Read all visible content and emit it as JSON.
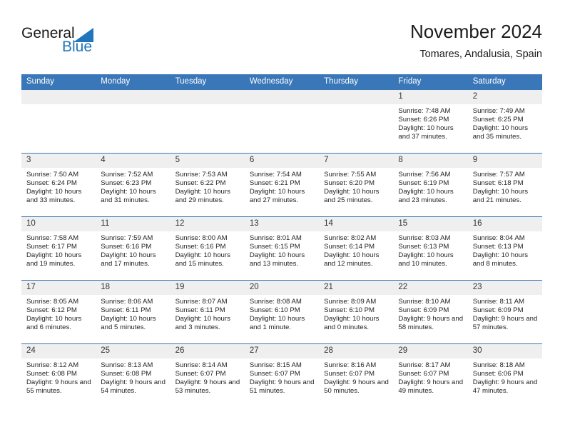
{
  "logo": {
    "word_top": "General",
    "word_bottom": "Blue",
    "accent_color": "#1f76bc"
  },
  "header": {
    "title": "November 2024",
    "subtitle": "Tomares, Andalusia, Spain"
  },
  "theme": {
    "header_bar": "#3a77b8",
    "daynum_band": "#efefef",
    "rule": "#3a77b8"
  },
  "weekday_headers": [
    "Sunday",
    "Monday",
    "Tuesday",
    "Wednesday",
    "Thursday",
    "Friday",
    "Saturday"
  ],
  "weeks": [
    [
      {
        "day": "",
        "empty": true
      },
      {
        "day": "",
        "empty": true
      },
      {
        "day": "",
        "empty": true
      },
      {
        "day": "",
        "empty": true
      },
      {
        "day": "",
        "empty": true
      },
      {
        "day": "1",
        "sunrise": "Sunrise: 7:48 AM",
        "sunset": "Sunset: 6:26 PM",
        "daylight": "Daylight: 10 hours and 37 minutes."
      },
      {
        "day": "2",
        "sunrise": "Sunrise: 7:49 AM",
        "sunset": "Sunset: 6:25 PM",
        "daylight": "Daylight: 10 hours and 35 minutes."
      }
    ],
    [
      {
        "day": "3",
        "sunrise": "Sunrise: 7:50 AM",
        "sunset": "Sunset: 6:24 PM",
        "daylight": "Daylight: 10 hours and 33 minutes."
      },
      {
        "day": "4",
        "sunrise": "Sunrise: 7:52 AM",
        "sunset": "Sunset: 6:23 PM",
        "daylight": "Daylight: 10 hours and 31 minutes."
      },
      {
        "day": "5",
        "sunrise": "Sunrise: 7:53 AM",
        "sunset": "Sunset: 6:22 PM",
        "daylight": "Daylight: 10 hours and 29 minutes."
      },
      {
        "day": "6",
        "sunrise": "Sunrise: 7:54 AM",
        "sunset": "Sunset: 6:21 PM",
        "daylight": "Daylight: 10 hours and 27 minutes."
      },
      {
        "day": "7",
        "sunrise": "Sunrise: 7:55 AM",
        "sunset": "Sunset: 6:20 PM",
        "daylight": "Daylight: 10 hours and 25 minutes."
      },
      {
        "day": "8",
        "sunrise": "Sunrise: 7:56 AM",
        "sunset": "Sunset: 6:19 PM",
        "daylight": "Daylight: 10 hours and 23 minutes."
      },
      {
        "day": "9",
        "sunrise": "Sunrise: 7:57 AM",
        "sunset": "Sunset: 6:18 PM",
        "daylight": "Daylight: 10 hours and 21 minutes."
      }
    ],
    [
      {
        "day": "10",
        "sunrise": "Sunrise: 7:58 AM",
        "sunset": "Sunset: 6:17 PM",
        "daylight": "Daylight: 10 hours and 19 minutes."
      },
      {
        "day": "11",
        "sunrise": "Sunrise: 7:59 AM",
        "sunset": "Sunset: 6:16 PM",
        "daylight": "Daylight: 10 hours and 17 minutes."
      },
      {
        "day": "12",
        "sunrise": "Sunrise: 8:00 AM",
        "sunset": "Sunset: 6:16 PM",
        "daylight": "Daylight: 10 hours and 15 minutes."
      },
      {
        "day": "13",
        "sunrise": "Sunrise: 8:01 AM",
        "sunset": "Sunset: 6:15 PM",
        "daylight": "Daylight: 10 hours and 13 minutes."
      },
      {
        "day": "14",
        "sunrise": "Sunrise: 8:02 AM",
        "sunset": "Sunset: 6:14 PM",
        "daylight": "Daylight: 10 hours and 12 minutes."
      },
      {
        "day": "15",
        "sunrise": "Sunrise: 8:03 AM",
        "sunset": "Sunset: 6:13 PM",
        "daylight": "Daylight: 10 hours and 10 minutes."
      },
      {
        "day": "16",
        "sunrise": "Sunrise: 8:04 AM",
        "sunset": "Sunset: 6:13 PM",
        "daylight": "Daylight: 10 hours and 8 minutes."
      }
    ],
    [
      {
        "day": "17",
        "sunrise": "Sunrise: 8:05 AM",
        "sunset": "Sunset: 6:12 PM",
        "daylight": "Daylight: 10 hours and 6 minutes."
      },
      {
        "day": "18",
        "sunrise": "Sunrise: 8:06 AM",
        "sunset": "Sunset: 6:11 PM",
        "daylight": "Daylight: 10 hours and 5 minutes."
      },
      {
        "day": "19",
        "sunrise": "Sunrise: 8:07 AM",
        "sunset": "Sunset: 6:11 PM",
        "daylight": "Daylight: 10 hours and 3 minutes."
      },
      {
        "day": "20",
        "sunrise": "Sunrise: 8:08 AM",
        "sunset": "Sunset: 6:10 PM",
        "daylight": "Daylight: 10 hours and 1 minute."
      },
      {
        "day": "21",
        "sunrise": "Sunrise: 8:09 AM",
        "sunset": "Sunset: 6:10 PM",
        "daylight": "Daylight: 10 hours and 0 minutes."
      },
      {
        "day": "22",
        "sunrise": "Sunrise: 8:10 AM",
        "sunset": "Sunset: 6:09 PM",
        "daylight": "Daylight: 9 hours and 58 minutes."
      },
      {
        "day": "23",
        "sunrise": "Sunrise: 8:11 AM",
        "sunset": "Sunset: 6:09 PM",
        "daylight": "Daylight: 9 hours and 57 minutes."
      }
    ],
    [
      {
        "day": "24",
        "sunrise": "Sunrise: 8:12 AM",
        "sunset": "Sunset: 6:08 PM",
        "daylight": "Daylight: 9 hours and 55 minutes."
      },
      {
        "day": "25",
        "sunrise": "Sunrise: 8:13 AM",
        "sunset": "Sunset: 6:08 PM",
        "daylight": "Daylight: 9 hours and 54 minutes."
      },
      {
        "day": "26",
        "sunrise": "Sunrise: 8:14 AM",
        "sunset": "Sunset: 6:07 PM",
        "daylight": "Daylight: 9 hours and 53 minutes."
      },
      {
        "day": "27",
        "sunrise": "Sunrise: 8:15 AM",
        "sunset": "Sunset: 6:07 PM",
        "daylight": "Daylight: 9 hours and 51 minutes."
      },
      {
        "day": "28",
        "sunrise": "Sunrise: 8:16 AM",
        "sunset": "Sunset: 6:07 PM",
        "daylight": "Daylight: 9 hours and 50 minutes."
      },
      {
        "day": "29",
        "sunrise": "Sunrise: 8:17 AM",
        "sunset": "Sunset: 6:07 PM",
        "daylight": "Daylight: 9 hours and 49 minutes."
      },
      {
        "day": "30",
        "sunrise": "Sunrise: 8:18 AM",
        "sunset": "Sunset: 6:06 PM",
        "daylight": "Daylight: 9 hours and 47 minutes."
      }
    ]
  ]
}
